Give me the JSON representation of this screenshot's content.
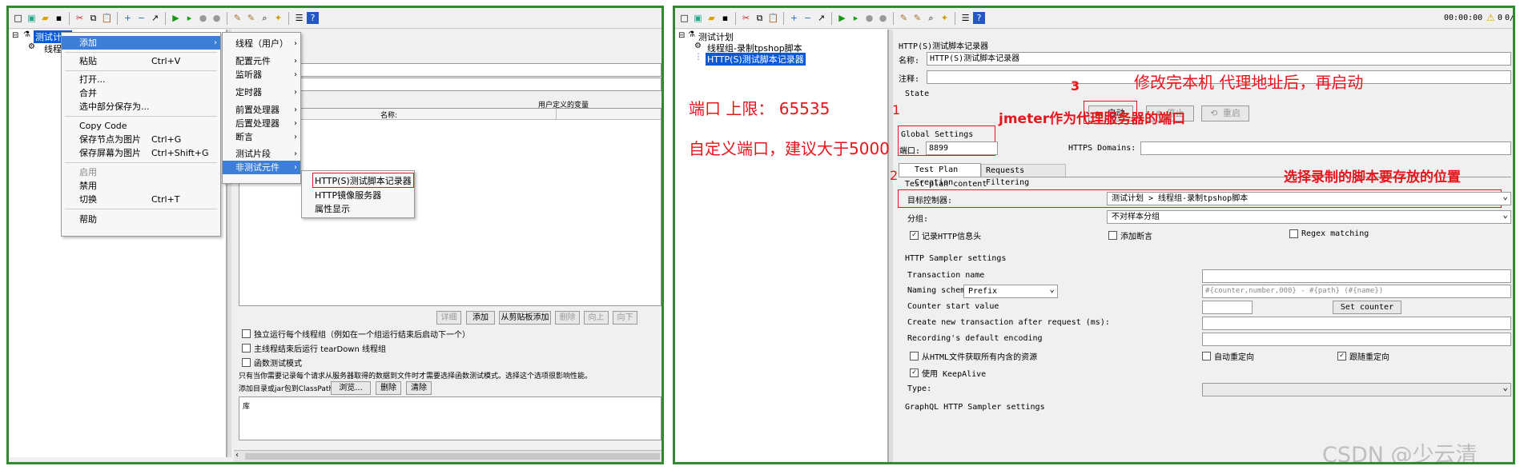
{
  "left": {
    "tree": {
      "root": "测试计划",
      "child": "线程"
    },
    "context_menu": {
      "items": [
        {
          "label": "添加",
          "shortcut": "",
          "submenu": true,
          "state": "highlight"
        },
        {
          "label": "粘贴",
          "shortcut": "Ctrl+V"
        },
        {
          "label": "打开...",
          "shortcut": ""
        },
        {
          "label": "合并",
          "shortcut": ""
        },
        {
          "label": "选中部分保存为...",
          "shortcut": ""
        },
        {
          "label": "Copy Code",
          "shortcut": ""
        },
        {
          "label": "保存节点为图片",
          "shortcut": "Ctrl+G"
        },
        {
          "label": "保存屏幕为图片",
          "shortcut": "Ctrl+Shift+G"
        },
        {
          "label": "启用",
          "shortcut": "",
          "state": "disabled"
        },
        {
          "label": "禁用",
          "shortcut": ""
        },
        {
          "label": "切换",
          "shortcut": "Ctrl+T"
        },
        {
          "label": "帮助",
          "shortcut": ""
        }
      ]
    },
    "add_submenu": [
      "线程（用户）",
      "配置元件",
      "监听器",
      "定时器",
      "前置处理器",
      "后置处理器",
      "断言",
      "测试片段",
      "非测试元件"
    ],
    "non_test_submenu": [
      "HTTP(S)测试脚本记录器",
      "HTTP镜像服务器",
      "属性显示"
    ],
    "udv": {
      "title": "用户定义的变量",
      "col_name": "名称:"
    },
    "buttons": [
      "详细",
      "添加",
      "从剪贴板添加",
      "删除",
      "向上",
      "向下"
    ],
    "options": [
      "独立运行每个线程组（例如在一个组运行结束后启动下一个）",
      "主线程结束后运行 tearDown 线程组",
      "函数测试模式"
    ],
    "note": "只有当你需要记录每个请求从服务器取得的数据到文件时才需要选择函数测试模式。选择这个选项很影响性能。",
    "classpath": {
      "label": "添加目录或jar包到ClassPath",
      "browse": "浏览...",
      "delete": "删除",
      "clear": "清除",
      "lib": "库"
    }
  },
  "right": {
    "status": {
      "time": "00:00:00",
      "warn": "0",
      "count": "0/"
    },
    "tree": {
      "root": "测试计划",
      "thread_group": "线程组-录制tpshop脚本",
      "recorder": "HTTP(S)测试脚本记录器"
    },
    "title": "HTTP(S)测试脚本记录器",
    "name_label": "名称:",
    "name_value": "HTTP(S)测试脚本记录器",
    "comment_label": "注释:",
    "state_label": "State",
    "start_button": "启动",
    "stop_button": "停止",
    "restart_button": "重启",
    "global_settings": "Global Settings",
    "port_label": "端口:",
    "port_value": "8899",
    "https_domains": "HTTPS Domains:",
    "tabs": [
      "Test Plan Creation",
      "Requests Filtering"
    ],
    "test_plan_content": "Test plan content",
    "target_controller_label": "目标控制器:",
    "target_controller_value": "测试计划 > 线程组-录制tpshop脚本",
    "grouping_label": "分组:",
    "grouping_value": "不对样本分组",
    "record_headers": "记录HTTP信息头",
    "add_assertions": "添加断言",
    "regex_matching": "Regex matching",
    "sampler_settings": "HTTP Sampler settings",
    "transaction_name": "Transaction name",
    "naming_scheme": "Naming scheme",
    "naming_scheme_value": "Prefix",
    "naming_format": "#{counter,number,000} - #{path} (#{name})",
    "counter_start": "Counter start value",
    "set_counter": "Set counter",
    "create_transaction": "Create new transaction after request (ms):",
    "recording_encoding": "Recording's default encoding",
    "fetch_embedded": "从HTML文件获取所有内含的资源",
    "auto_redirect": "自动重定向",
    "follow_redirect": "跟随重定向",
    "keepalive": "使用 KeepAlive",
    "type_label": "Type:",
    "graphql": "GraphQL HTTP Sampler settings"
  },
  "annotations": {
    "port_range": "端口 上限：   65535",
    "port_advice": "自定义端口，建议大于5000",
    "n1": "1",
    "n1_text": "jmeter作为代理服务器的端口",
    "n2": "2",
    "n2_text": "选择录制的脚本要存放的位置",
    "n3": "3",
    "n3_text": "修改完本机 代理地址后，再启动"
  },
  "watermark": "CSDN @少云清",
  "colors": {
    "frame": "#2e8b2e",
    "annotation": "#e8141c",
    "selection": "#0a5ad8",
    "start_green": "#1a9a1a"
  }
}
